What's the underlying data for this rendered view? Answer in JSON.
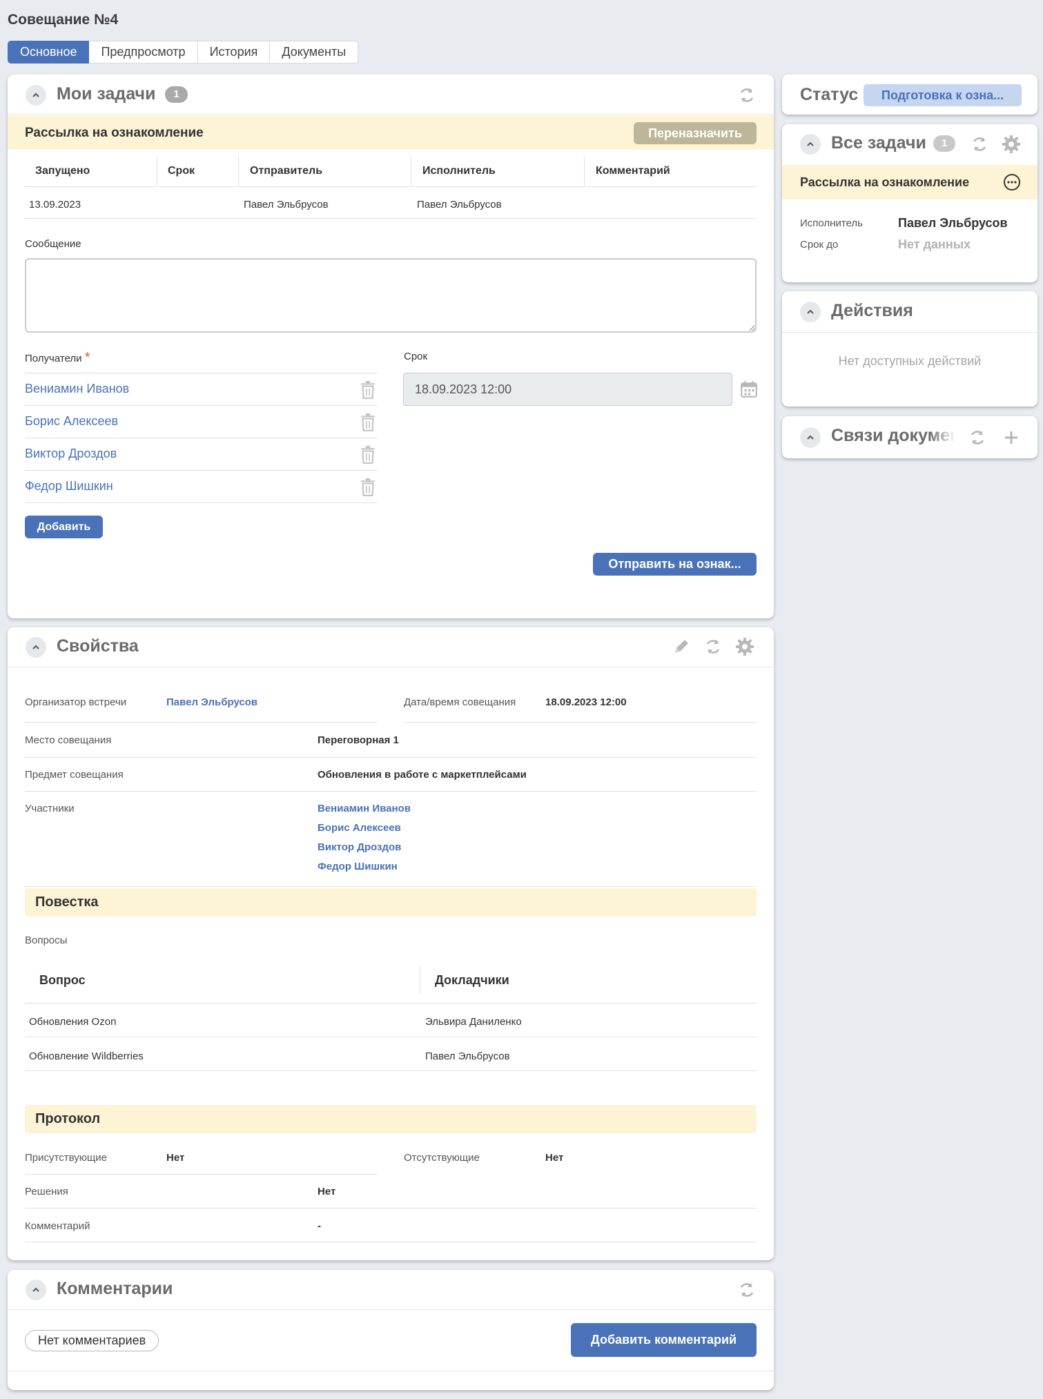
{
  "page": {
    "title": "Совещание №4"
  },
  "tabs": [
    "Основное",
    "Предпросмотр",
    "История",
    "Документы"
  ],
  "my_tasks": {
    "title": "Мои задачи",
    "count": "1",
    "task_title": "Рассылка на ознакомление",
    "reassign_label": "Переназначить",
    "columns": [
      "Запущено",
      "Срок",
      "Отправитель",
      "Исполнитель",
      "Комментарий"
    ],
    "row": {
      "started": "13.09.2023",
      "deadline": "",
      "sender": "Павел Эльбрусов",
      "executor": "Павел Эльбрусов",
      "comment": ""
    },
    "message_label": "Сообщение",
    "message_value": "",
    "recipients_label": "Получатели",
    "required_mark": "*",
    "recipients": [
      "Вениамин Иванов",
      "Борис Алексеев",
      "Виктор Дроздов",
      "Федор Шишкин"
    ],
    "add_label": "Добавить",
    "deadline_label": "Срок",
    "deadline_value": "18.09.2023 12:00",
    "send_label": "Отправить на ознак..."
  },
  "properties": {
    "title": "Свойства",
    "organizer_label": "Организатор встречи",
    "organizer": "Павел Эльбрусов",
    "datetime_label": "Дата/время совещания",
    "datetime": "18.09.2023 12:00",
    "place_label": "Место совещания",
    "place": "Переговорная 1",
    "subject_label": "Предмет совещания",
    "subject": "Обновления в работе с маркетплейсами",
    "participants_label": "Участники",
    "participants": [
      "Вениамин Иванов",
      "Борис Алексеев",
      "Виктор Дроздов",
      "Федор Шишкин"
    ],
    "agenda_title": "Повестка",
    "questions_label": "Вопросы",
    "q_columns": [
      "Вопрос",
      "Докладчики"
    ],
    "questions": [
      {
        "question": "Обновления Ozon",
        "speaker": "Эльвира Даниленко"
      },
      {
        "question": "Обновление Wildberries",
        "speaker": "Павел Эльбрусов"
      }
    ],
    "protocol_title": "Протокол",
    "present_label": "Присутствующие",
    "present": "Нет",
    "absent_label": "Отсутствующие",
    "absent": "Нет",
    "decisions_label": "Решения",
    "decisions": "Нет",
    "comment_label": "Комментарий",
    "comment": "-"
  },
  "comments": {
    "title": "Комментарии",
    "empty_label": "Нет комментариев",
    "add_label": "Добавить комментарий"
  },
  "status": {
    "label": "Статус",
    "value": "Подготовка к озна..."
  },
  "all_tasks": {
    "title": "Все задачи",
    "count": "1",
    "task_title": "Рассылка на ознакомление",
    "executor_label": "Исполнитель",
    "executor": "Павел Эльбрусов",
    "due_label": "Срок до",
    "due": "Нет данных"
  },
  "actions": {
    "title": "Действия",
    "empty": "Нет доступных действий"
  },
  "links": {
    "title": "Связи докумен"
  },
  "colors": {
    "accent": "#4a72b8",
    "band": "#fdf4d6",
    "required": "#e05a1e"
  }
}
